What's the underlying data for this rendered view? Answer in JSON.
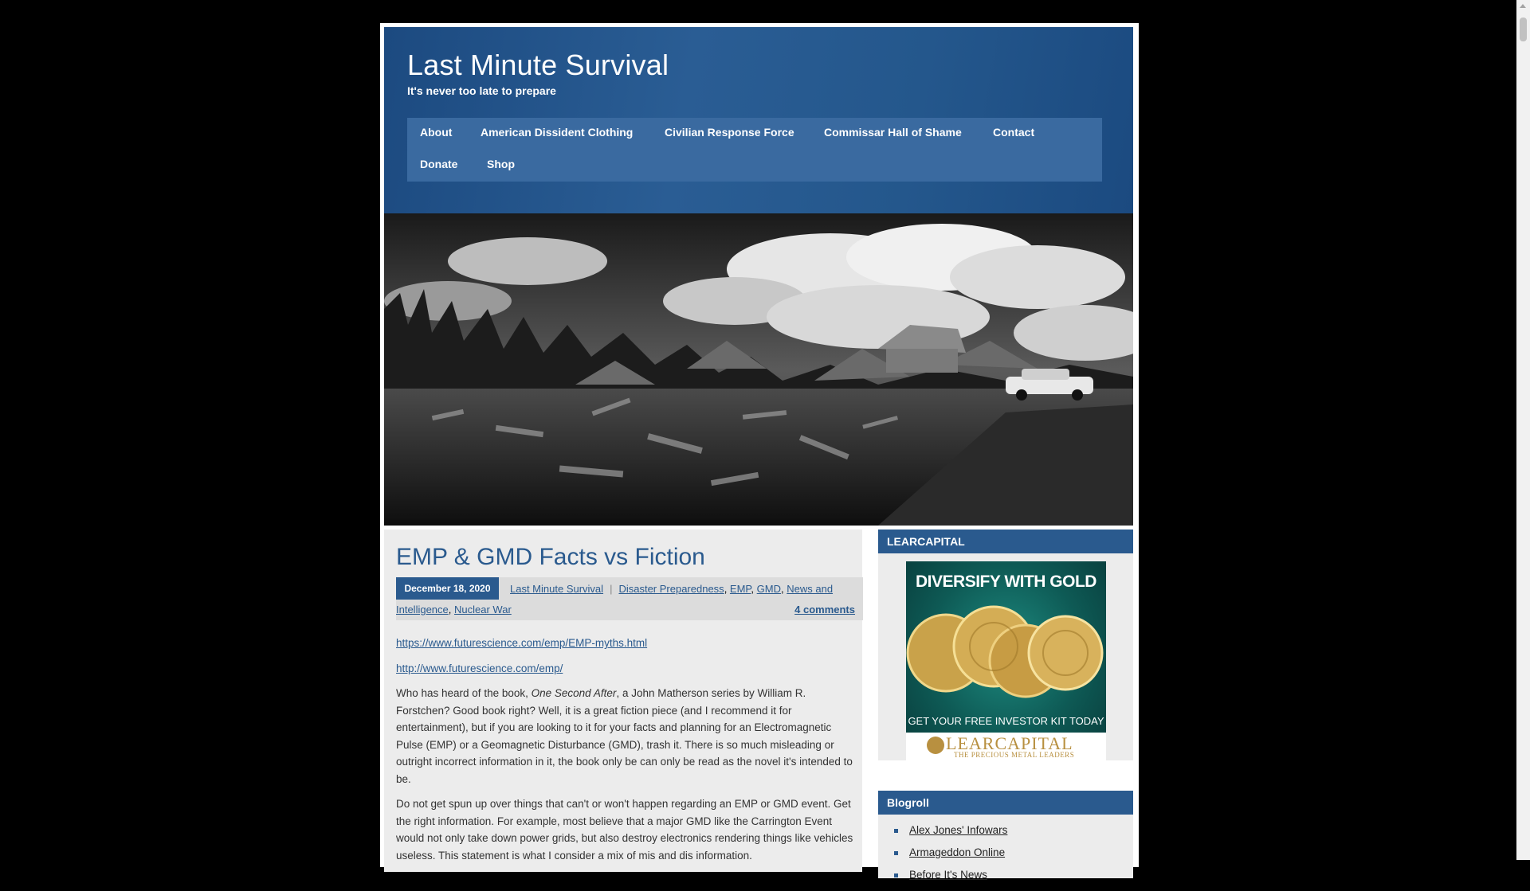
{
  "site": {
    "title": "Last Minute Survival",
    "tagline": "It's never too late to prepare"
  },
  "nav": {
    "items": [
      {
        "label": "About"
      },
      {
        "label": "American Dissident Clothing"
      },
      {
        "label": "Civilian Response Force"
      },
      {
        "label": "Commissar Hall of Shame"
      },
      {
        "label": "Contact"
      },
      {
        "label": "Donate"
      },
      {
        "label": "Shop"
      }
    ]
  },
  "post": {
    "title": "EMP & GMD Facts vs Fiction",
    "date": "December 18, 2020",
    "author": "Last Minute Survival",
    "categories": [
      "Disaster Preparedness",
      "EMP",
      "GMD",
      "News and",
      "Intelligence",
      "Nuclear War"
    ],
    "comments": "4 comments",
    "link1": "https://www.futurescience.com/emp/EMP-myths.html",
    "link2": "http://www.futurescience.com/emp/",
    "p1_a": "Who has heard of the book, ",
    "p1_book": "One Second After",
    "p1_b": ", a John Matherson series by William R. Forstchen? Good book right? Well, it is a great fiction piece (and I recommend it for entertainment), but if you are looking to it for your facts and planning for an Electromagnetic Pulse (EMP) or a Geomagnetic Disturbance (GMD), trash it. There is so much misleading or outright incorrect information in it, the book only be can only be read as the novel it's intended to be.",
    "p2": "Do not get spun up over things that can't or won't happen regarding an EMP or GMD event. Get the right information. For example, most believe that a major GMD like the Carrington Event would not only take down power grids, but also destroy electronics rendering things like vehicles useless. This statement is what I consider a mix of mis and dis information."
  },
  "sidebar": {
    "ad_widget_title": "LEARCAPITAL",
    "ad": {
      "headline": "DIVERSIFY WITH GOLD",
      "cta": "GET YOUR FREE INVESTOR KIT TODAY",
      "brand": "LEARCAPITAL",
      "brand_sub": "THE PRECIOUS METAL LEADERS"
    },
    "blogroll_title": "Blogroll",
    "blogroll": [
      {
        "label": "Alex Jones' Infowars"
      },
      {
        "label": "Armageddon Online"
      },
      {
        "label": "Before It's News"
      }
    ]
  },
  "colors": {
    "header_blue": "#2a5a8e",
    "nav_blue": "#3a6aa0",
    "page_bg": "#000000"
  }
}
